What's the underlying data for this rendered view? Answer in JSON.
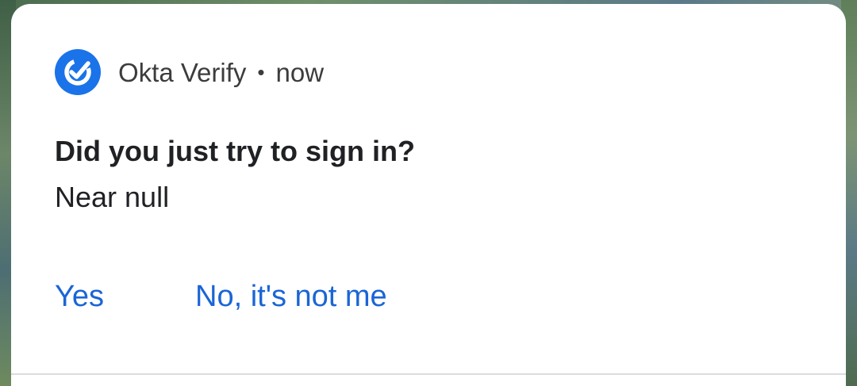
{
  "notification": {
    "app_name": "Okta Verify",
    "separator": "•",
    "timestamp": "now",
    "app_icon": "okta-verify-check-icon",
    "title": "Did you just try to sign in?",
    "body": "Near null",
    "actions": {
      "yes_label": "Yes",
      "no_label": "No, it's not me"
    }
  },
  "colors": {
    "accent": "#1a73e8",
    "action_text": "#1a65d6",
    "title_text": "#202124"
  }
}
